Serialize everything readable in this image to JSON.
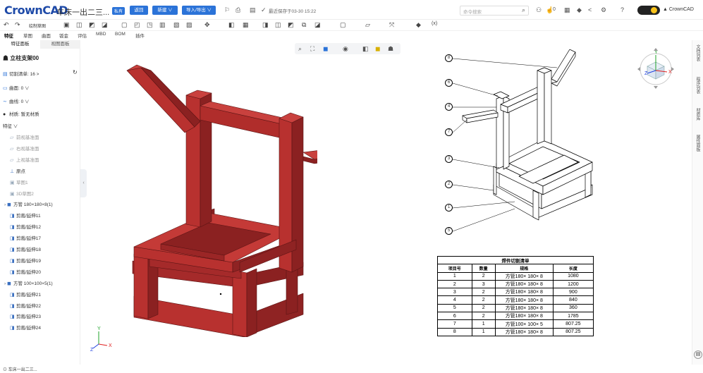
{
  "header": {
    "logo": "CrownCAD",
    "doc_title": "车床一出二三...",
    "badge": "私有",
    "return_label": "返回",
    "new_label": "新建 ∨",
    "import_export_label": "导入/导出 ∨",
    "saved_text": "最近保存于03-30 15:22",
    "search_placeholder": "命令搜索",
    "like_count": "0",
    "user": "CrownCAD"
  },
  "toolbar2": {
    "sketch_label": "绘制草图"
  },
  "tabs": [
    "特征",
    "草图",
    "曲面",
    "钣金",
    "评估",
    "MBD",
    "BOM",
    "插件"
  ],
  "panel": {
    "tab_features": "特征面板",
    "tab_views": "视图面板",
    "part_name": "立柱支架00",
    "rows": [
      {
        "icon": "cutlist-icon",
        "label": "切割清单: 16 >"
      },
      {
        "icon": "surface-icon",
        "label": "曲面: 0 ∨"
      },
      {
        "icon": "curve-icon",
        "label": "曲线: 0 ∨"
      },
      {
        "icon": "material-icon",
        "label": "材质: 暂无材质"
      },
      {
        "icon": "",
        "label": "特征 ∨"
      }
    ],
    "tree": [
      {
        "label": "前视基准面",
        "icon": "plane-icon",
        "gray": true
      },
      {
        "label": "右视基准面",
        "icon": "plane-icon",
        "gray": true
      },
      {
        "label": "上视基准面",
        "icon": "plane-icon",
        "gray": true
      },
      {
        "label": "原点",
        "icon": "origin-icon",
        "gray": false
      },
      {
        "label": "草图1",
        "icon": "sketch-icon",
        "gray": true
      },
      {
        "label": "3D草图2",
        "icon": "sketch3d-icon",
        "gray": true
      },
      {
        "label": "方管 180×180×8(1)",
        "icon": "tube-icon",
        "gray": false
      },
      {
        "label": "剪裁/延伸11",
        "icon": "trim-icon",
        "gray": false
      },
      {
        "label": "剪裁/延伸12",
        "icon": "trim-icon",
        "gray": false
      },
      {
        "label": "剪裁/延伸17",
        "icon": "trim-icon",
        "gray": false
      },
      {
        "label": "剪裁/延伸18",
        "icon": "trim-icon",
        "gray": false
      },
      {
        "label": "剪裁/延伸19",
        "icon": "trim-icon",
        "gray": false
      },
      {
        "label": "剪裁/延伸20",
        "icon": "trim-icon",
        "gray": false
      },
      {
        "label": "方管 100×100×5(1)",
        "icon": "tube-icon",
        "gray": false
      },
      {
        "label": "剪裁/延伸21",
        "icon": "trim-icon",
        "gray": false
      },
      {
        "label": "剪裁/延伸22",
        "icon": "trim-icon",
        "gray": false
      },
      {
        "label": "剪裁/延伸23",
        "icon": "trim-icon",
        "gray": false
      },
      {
        "label": "剪裁/延伸24",
        "icon": "trim-icon",
        "gray": false
      }
    ]
  },
  "rightbar": [
    "文档列表",
    "程序列表",
    "材质库",
    "属性面板"
  ],
  "bom": {
    "title": "焊件切割清单",
    "headers": [
      "项目号",
      "数量",
      "规格",
      "长度"
    ],
    "rows": [
      [
        "1",
        "2",
        "方管180× 180× 8",
        "1080"
      ],
      [
        "2",
        "3",
        "方管180× 180× 8",
        "1200"
      ],
      [
        "3",
        "2",
        "方管180× 180× 8",
        "900"
      ],
      [
        "4",
        "2",
        "方管180× 180× 8",
        "840"
      ],
      [
        "5",
        "2",
        "方管180× 180× 8",
        "360"
      ],
      [
        "6",
        "2",
        "方管180× 180× 8",
        "1785"
      ],
      [
        "7",
        "1",
        "方管100× 100× 5",
        "807.25"
      ],
      [
        "8",
        "1",
        "方管180× 180× 8",
        "807.25"
      ]
    ]
  },
  "balloons": [
    "8",
    "6",
    "4",
    "7",
    "3",
    "2",
    "1",
    "5"
  ],
  "axes": {
    "x": "X",
    "y": "Y",
    "z": "Z"
  },
  "footer": "车床一出二三...",
  "colors": {
    "accent": "#2b73d8",
    "model": "#b8312f"
  }
}
